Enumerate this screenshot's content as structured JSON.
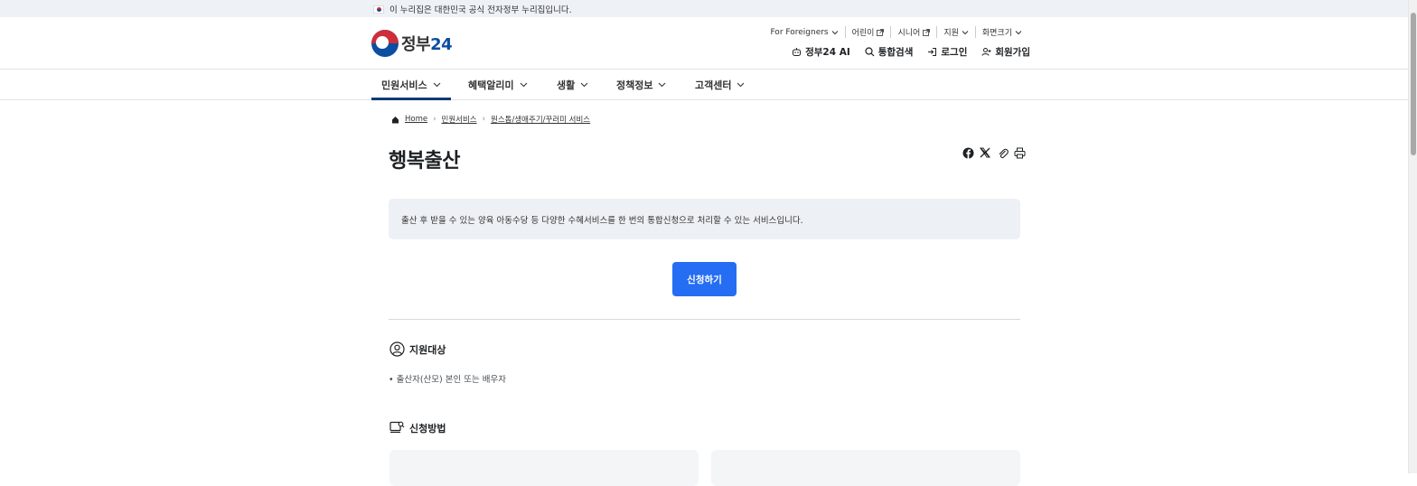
{
  "notice": {
    "text": "이 누리집은 대한민국 공식 전자정부 누리집입니다."
  },
  "logo": {
    "text_a": "정부",
    "text_b": "24"
  },
  "utility_top": {
    "foreigners": "For Foreigners",
    "children": "어린이",
    "senior": "시니어",
    "support": "지원",
    "screen_size": "화면크기"
  },
  "utility_bottom": {
    "ai": "정부24 AI",
    "search": "통합검색",
    "login": "로그인",
    "signup": "회원가입"
  },
  "gnb": [
    {
      "label": "민원서비스"
    },
    {
      "label": "혜택알리미"
    },
    {
      "label": "생활"
    },
    {
      "label": "정책정보"
    },
    {
      "label": "고객센터"
    }
  ],
  "breadcrumb": {
    "home": "Home",
    "level1": "민원서비스",
    "level2": "원스톱/생애주기/꾸러미 서비스"
  },
  "page_title": "행복출산",
  "description": "출산 후 받을 수 있는 양육 아동수당 등 다양한 수혜서비스를 한 번의 통합신청으로 처리할 수 있는 서비스입니다.",
  "apply_button": "신청하기",
  "section_target": {
    "title": "지원대상",
    "items": [
      "출산자(산모) 본인 또는 배우자"
    ]
  },
  "section_method": {
    "title": "신청방법"
  },
  "colors": {
    "primary": "#256ef4",
    "nav_active": "#063a74",
    "desc_bg": "#edf0f4"
  }
}
